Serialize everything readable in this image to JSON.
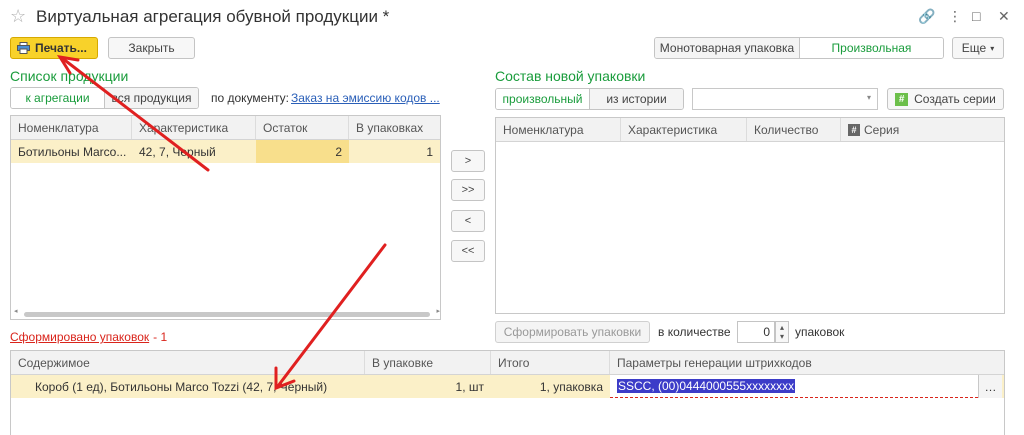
{
  "window": {
    "title": "Виртуальная агрегация обувной продукции *",
    "controls": [
      "🔗",
      "⋮",
      "□",
      "✕"
    ]
  },
  "toolbar": {
    "print_label": "Печать...",
    "close_label": "Закрыть",
    "packaging_modes": [
      "Монотоварная упаковка",
      "Произвольная"
    ],
    "packaging_selected": "Произвольная",
    "more_label": "Еще"
  },
  "products": {
    "title": "Список продукции",
    "filter_tabs": [
      "к агрегации",
      "вся продукция"
    ],
    "filter_selected": "к агрегации",
    "by_document_label": "по документу:",
    "document_link": "Заказ на эмиссию кодов ...",
    "columns": [
      "Номенклатура",
      "Характеристика",
      "Остаток",
      "В упаковках"
    ],
    "rows": [
      {
        "name": "Ботильоны Marco...",
        "characteristic": "42, 7, Черный",
        "remainder": "2",
        "in_packages": "1"
      }
    ]
  },
  "transfer_buttons": [
    ">",
    ">>",
    "<",
    "<<"
  ],
  "new_package": {
    "title": "Состав новой упаковки",
    "source_tabs": [
      "произвольный",
      "из истории"
    ],
    "source_selected": "произвольный",
    "create_series_label": "Создать серии",
    "columns": [
      "Номенклатура",
      "Характеристика",
      "Количество",
      "Серия"
    ]
  },
  "generate": {
    "button_label": "Сформировать упаковки",
    "quantity_label": "в количестве",
    "quantity_value": "0",
    "unit_label": "упаковок"
  },
  "formed": {
    "summary_link": "Сформировано упаковок",
    "summary_count": "- 1",
    "columns": [
      "Содержимое",
      "В упаковке",
      "Итого",
      "Параметры генерации штрихкодов"
    ],
    "rows": [
      {
        "content": "Короб (1 ед), Ботильоны Marco Tozzi (42, 7, Черный)",
        "in_package": "1, шт",
        "total": "1, упаковка",
        "barcode_params": "SSCC, (00)0444000555xxxxxxxx"
      }
    ]
  },
  "colors": {
    "accent_green": "#1a9c3c",
    "print_button": "#f8d22a",
    "selected_row": "#fbf0c8",
    "annotation_arrow": "#e02020"
  }
}
